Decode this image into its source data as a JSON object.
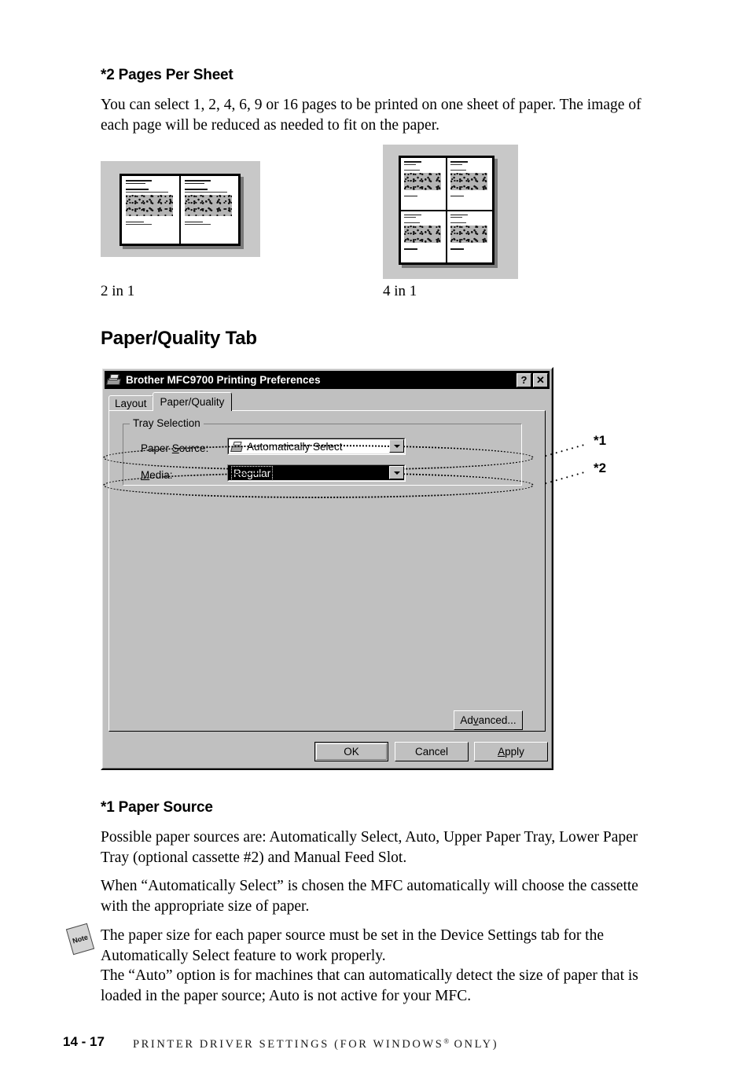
{
  "sections": {
    "pages_per_sheet": {
      "heading": "*2 Pages Per Sheet",
      "paragraph": "You can select 1, 2, 4, 6, 9 or 16 pages to be printed on one sheet of paper. The image of each page will be reduced as needed to fit on the paper.",
      "previews": [
        {
          "caption": "2 in 1",
          "layout": "2-up-landscape",
          "columns": 2,
          "rows": 1
        },
        {
          "caption": "4 in 1",
          "layout": "4-up-portrait",
          "columns": 2,
          "rows": 2
        }
      ]
    },
    "paper_quality": {
      "heading": "Paper/Quality Tab"
    },
    "paper_source": {
      "heading": "*1 Paper Source",
      "paragraph_1": "Possible paper sources are: Automatically Select, Auto, Upper Paper Tray, Lower Paper Tray (optional cassette #2) and Manual Feed Slot.",
      "paragraph_2": "When “Automatically Select” is chosen the MFC automatically will choose the cassette with the appropriate size of paper."
    },
    "note": {
      "icon_label": "Note",
      "line_1": "The paper size for each paper source must be set in the Device Settings tab for the Automatically Select feature to work properly.",
      "line_2": "The “Auto” option is for machines that can automatically detect the size of paper that is loaded in the paper source; Auto is not active for your MFC."
    }
  },
  "dialog": {
    "title": "Brother MFC9700 Printing Preferences",
    "titlebar_icon": "printer-icon",
    "titlebar_buttons": [
      {
        "name": "help-button",
        "label": "?"
      },
      {
        "name": "close-button",
        "label": "✕"
      }
    ],
    "tabs": [
      {
        "label": "Layout",
        "active": false
      },
      {
        "label": "Paper/Quality",
        "active": true
      }
    ],
    "group": {
      "legend": "Tray Selection",
      "fields": [
        {
          "id": "paper-source",
          "label": "Paper Source:",
          "label_prefix": "Paper ",
          "label_mnemonic": "S",
          "label_suffix": "ource:",
          "value": "Automatically Select",
          "icon": "printer-icon",
          "selected": false
        },
        {
          "id": "media",
          "label": "Media:",
          "label_prefix": "",
          "label_mnemonic": "M",
          "label_suffix": "edia:",
          "value": "Regular",
          "icon": "",
          "selected": true
        }
      ]
    },
    "buttons": {
      "advanced": {
        "prefix": "Ad",
        "mnemonic": "v",
        "suffix": "anced..."
      },
      "ok": {
        "prefix": "OK",
        "mnemonic": "",
        "suffix": ""
      },
      "cancel": {
        "prefix": "Cancel",
        "mnemonic": "",
        "suffix": ""
      },
      "apply": {
        "prefix": "",
        "mnemonic": "A",
        "suffix": "pply"
      }
    }
  },
  "callouts": [
    {
      "label": "*1",
      "target": "paper-source"
    },
    {
      "label": "*2",
      "target": "media"
    }
  ],
  "footer": {
    "page_number": "14 - 17",
    "running_head": "PRINTER DRIVER SETTINGS (FOR WINDOWS",
    "registered_mark": "®",
    "running_head_tail": " ONLY)"
  },
  "colors": {
    "dialog_face": "#c0c0c0",
    "titlebar": "#000000",
    "preview_background": "#c8c8c8",
    "selection": "#000000"
  }
}
